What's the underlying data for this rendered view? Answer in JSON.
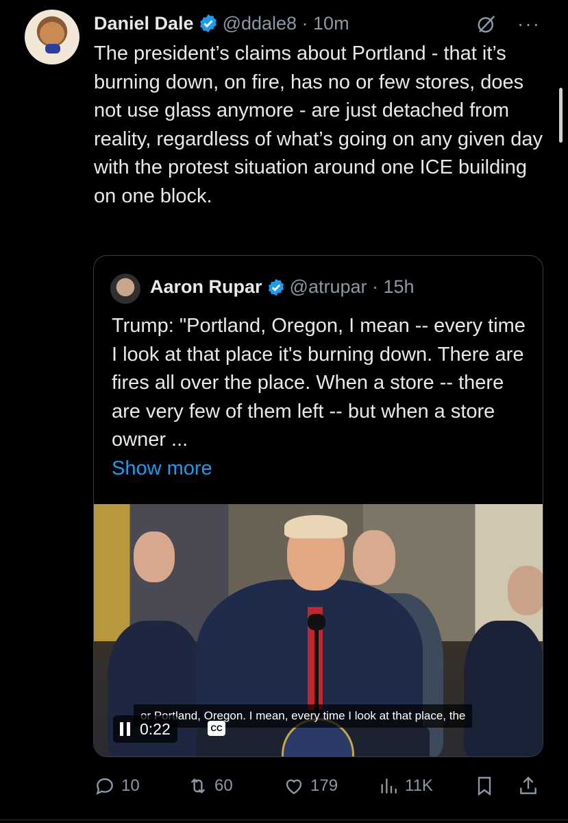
{
  "tweet": {
    "author_name": "Daniel Dale",
    "handle_time": "@ddale8 · 10m",
    "text": "The president’s claims about Portland - that it’s burning down, on fire, has no or few stores, does not use glass anymore - are just detached from reality, regardless of what’s going on any given day with the protest situation around one ICE building on one block.",
    "more_icon": "···"
  },
  "quote": {
    "author_name": "Aaron Rupar",
    "handle_time": "@atrupar · 15h",
    "text": "Trump: \"Portland, Oregon, I mean -- every time I look at that place it's burning down. There are fires all over the place. When a store -- there are very few of them left -- but when a store owner ...",
    "show_more": "Show more",
    "video": {
      "caption": "or Portland, Oregon. I mean, every time I look at that place, the",
      "time": "0:22",
      "cc_label": "CC"
    }
  },
  "actions": {
    "replies": "10",
    "reposts": "60",
    "likes": "179",
    "views": "11K"
  },
  "colors": {
    "accent": "#1d9bf0",
    "muted": "#8b98a5",
    "background": "#000000"
  }
}
